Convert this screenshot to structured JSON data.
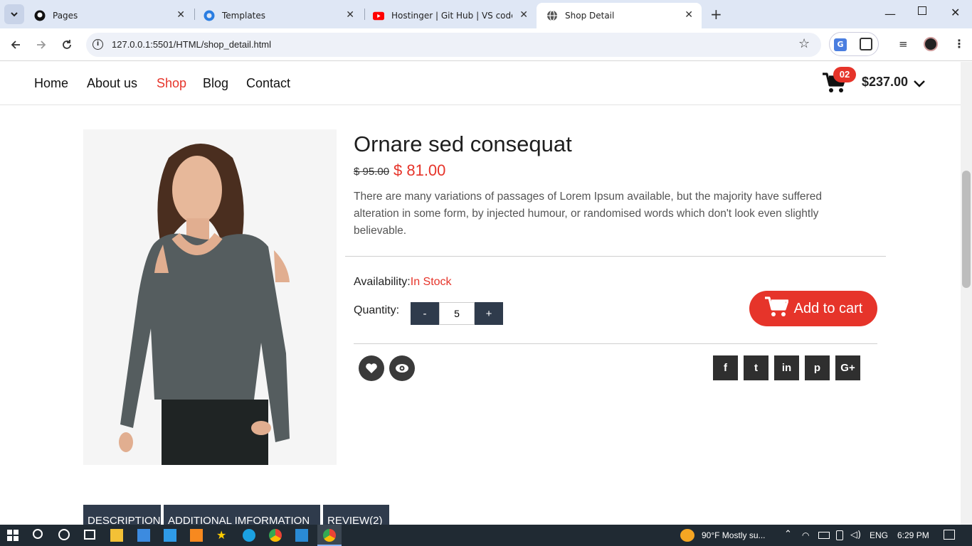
{
  "browser": {
    "tabs": [
      {
        "title": "Pages",
        "icon": "github-icon"
      },
      {
        "title": "Templates",
        "icon": "templates-icon"
      },
      {
        "title": "Hostinger | Git Hub | VS codeH",
        "icon": "youtube-icon"
      },
      {
        "title": "Shop Detail",
        "icon": "globe-icon"
      }
    ],
    "new_tab": "+",
    "url": "127.0.0.1:5501/HTML/shop_detail.html"
  },
  "nav": {
    "links": [
      "Home",
      "About us",
      "Shop",
      "Blog",
      "Contact"
    ],
    "active": "Shop",
    "cart_count": "02",
    "cart_total": "$237.00"
  },
  "product": {
    "title": "Ornare sed consequat",
    "old_price": "$ 95.00",
    "new_price": "$ 81.00",
    "description": "There are many variations of passages of Lorem Ipsum available, but the majority have suffered alteration in some form, by injected humour, or randomised words which don't look even slightly believable.",
    "availability_label": "Availability:",
    "availability_value": "In Stock",
    "quantity_label": "Quantity:",
    "qty_minus": "-",
    "qty_plus": "+",
    "quantity": "5",
    "add_to_cart": "Add to cart",
    "social": [
      "f",
      "t",
      "in",
      "p",
      "G+"
    ],
    "tabs": [
      "DESCRIPTION",
      "ADDITIONAL IMFORMATION",
      "REVIEW(2)"
    ]
  },
  "taskbar": {
    "weather": "90°F  Mostly su...",
    "lang": "ENG",
    "time": "6:29 PM"
  },
  "colors": {
    "accent": "#e6342a",
    "dark": "#2f3b4c"
  }
}
